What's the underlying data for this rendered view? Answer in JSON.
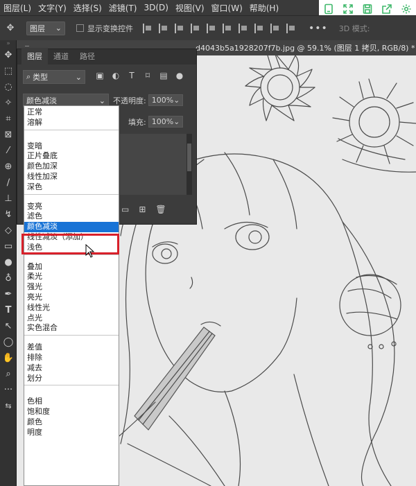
{
  "menubar": {
    "items": [
      "图层(L)",
      "文字(Y)",
      "选择(S)",
      "滤镜(T)",
      "3D(D)",
      "视图(V)",
      "窗口(W)",
      "帮助(H)"
    ]
  },
  "float_toolbar": {
    "icons": [
      "tablet-icon",
      "expand-icon",
      "save-icon",
      "share-icon",
      "gear-icon"
    ]
  },
  "options": {
    "layer_select": "图层",
    "show_transform": "显示变换控件",
    "more": "•••",
    "mode_3d": "3D 模式:"
  },
  "document": {
    "title": "d4043b5a1928207f7b.jpg @ 59.1% (图层 1 拷贝, RGB/8) *"
  },
  "layers_panel": {
    "tabs": [
      "图层",
      "通道",
      "路径"
    ],
    "filter_label": "类型",
    "blend_value": "颜色减淡",
    "opacity_label": "不透明度:",
    "opacity_value": "100%",
    "fill_label": "填充:",
    "fill_value": "100%"
  },
  "blend_modes": {
    "groups": [
      [
        "正常",
        "溶解"
      ],
      [
        "变暗",
        "正片叠底",
        "颜色加深",
        "线性加深",
        "深色"
      ],
      [
        "变亮",
        "滤色",
        "颜色减淡",
        "线性减淡（添加）",
        "浅色"
      ],
      [
        "叠加",
        "柔光",
        "强光",
        "亮光",
        "线性光",
        "点光",
        "实色混合"
      ],
      [
        "差值",
        "排除",
        "减去",
        "划分"
      ],
      [
        "色相",
        "饱和度",
        "颜色",
        "明度"
      ]
    ],
    "selected": "颜色减淡"
  },
  "colors": {
    "selection": "#1873d6",
    "highlight": "#d8202a",
    "accent": "#3fb86b"
  }
}
